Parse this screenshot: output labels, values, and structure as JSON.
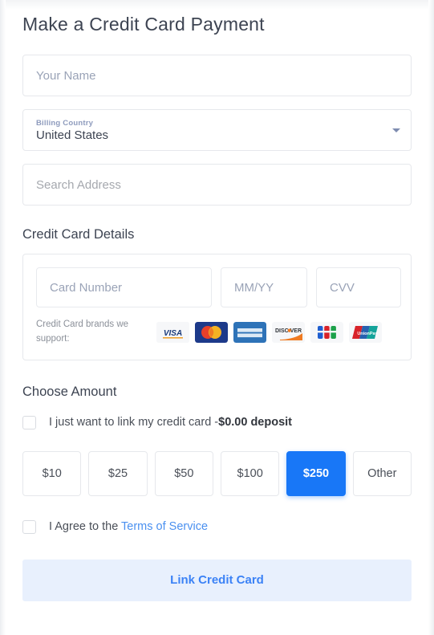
{
  "page": {
    "title": "Make a Credit Card Payment",
    "accent_color": "#1877f7",
    "link_color": "#4a90f0"
  },
  "form": {
    "name_field": {
      "placeholder": "Your Name",
      "value": ""
    },
    "billing_country": {
      "label": "Billing Country",
      "value": "United States"
    },
    "address_field": {
      "placeholder": "Search Address",
      "value": ""
    }
  },
  "card_section": {
    "heading": "Credit Card Details",
    "card_number": {
      "placeholder": "Card Number",
      "value": ""
    },
    "expiry": {
      "placeholder": "MM/YY",
      "value": ""
    },
    "cvv": {
      "placeholder": "CVV",
      "value": ""
    },
    "brands_label": "Credit Card brands we support:",
    "brands": [
      {
        "name": "visa",
        "text": "VISA"
      },
      {
        "name": "mastercard",
        "text": "mastercard"
      },
      {
        "name": "american-express",
        "text": "AMERICAN EXPRESS"
      },
      {
        "name": "discover",
        "text": "DISCOVER"
      },
      {
        "name": "jcb",
        "text": "JCB"
      },
      {
        "name": "unionpay",
        "text": "UnionPay"
      }
    ]
  },
  "amount_section": {
    "heading": "Choose Amount",
    "link_only_text_prefix": "I just want to link my credit card -",
    "link_only_text_bold": "$0.00 deposit",
    "link_only_checked": false,
    "options": [
      {
        "label": "$10",
        "selected": false
      },
      {
        "label": "$25",
        "selected": false
      },
      {
        "label": "$50",
        "selected": false
      },
      {
        "label": "$100",
        "selected": false
      },
      {
        "label": "$250",
        "selected": true
      },
      {
        "label": "Other",
        "selected": false
      }
    ],
    "selected_label": "$250"
  },
  "terms": {
    "prefix": "I Agree to the ",
    "link": "Terms of Service",
    "checked": false
  },
  "submit": {
    "label": "Link Credit Card"
  }
}
